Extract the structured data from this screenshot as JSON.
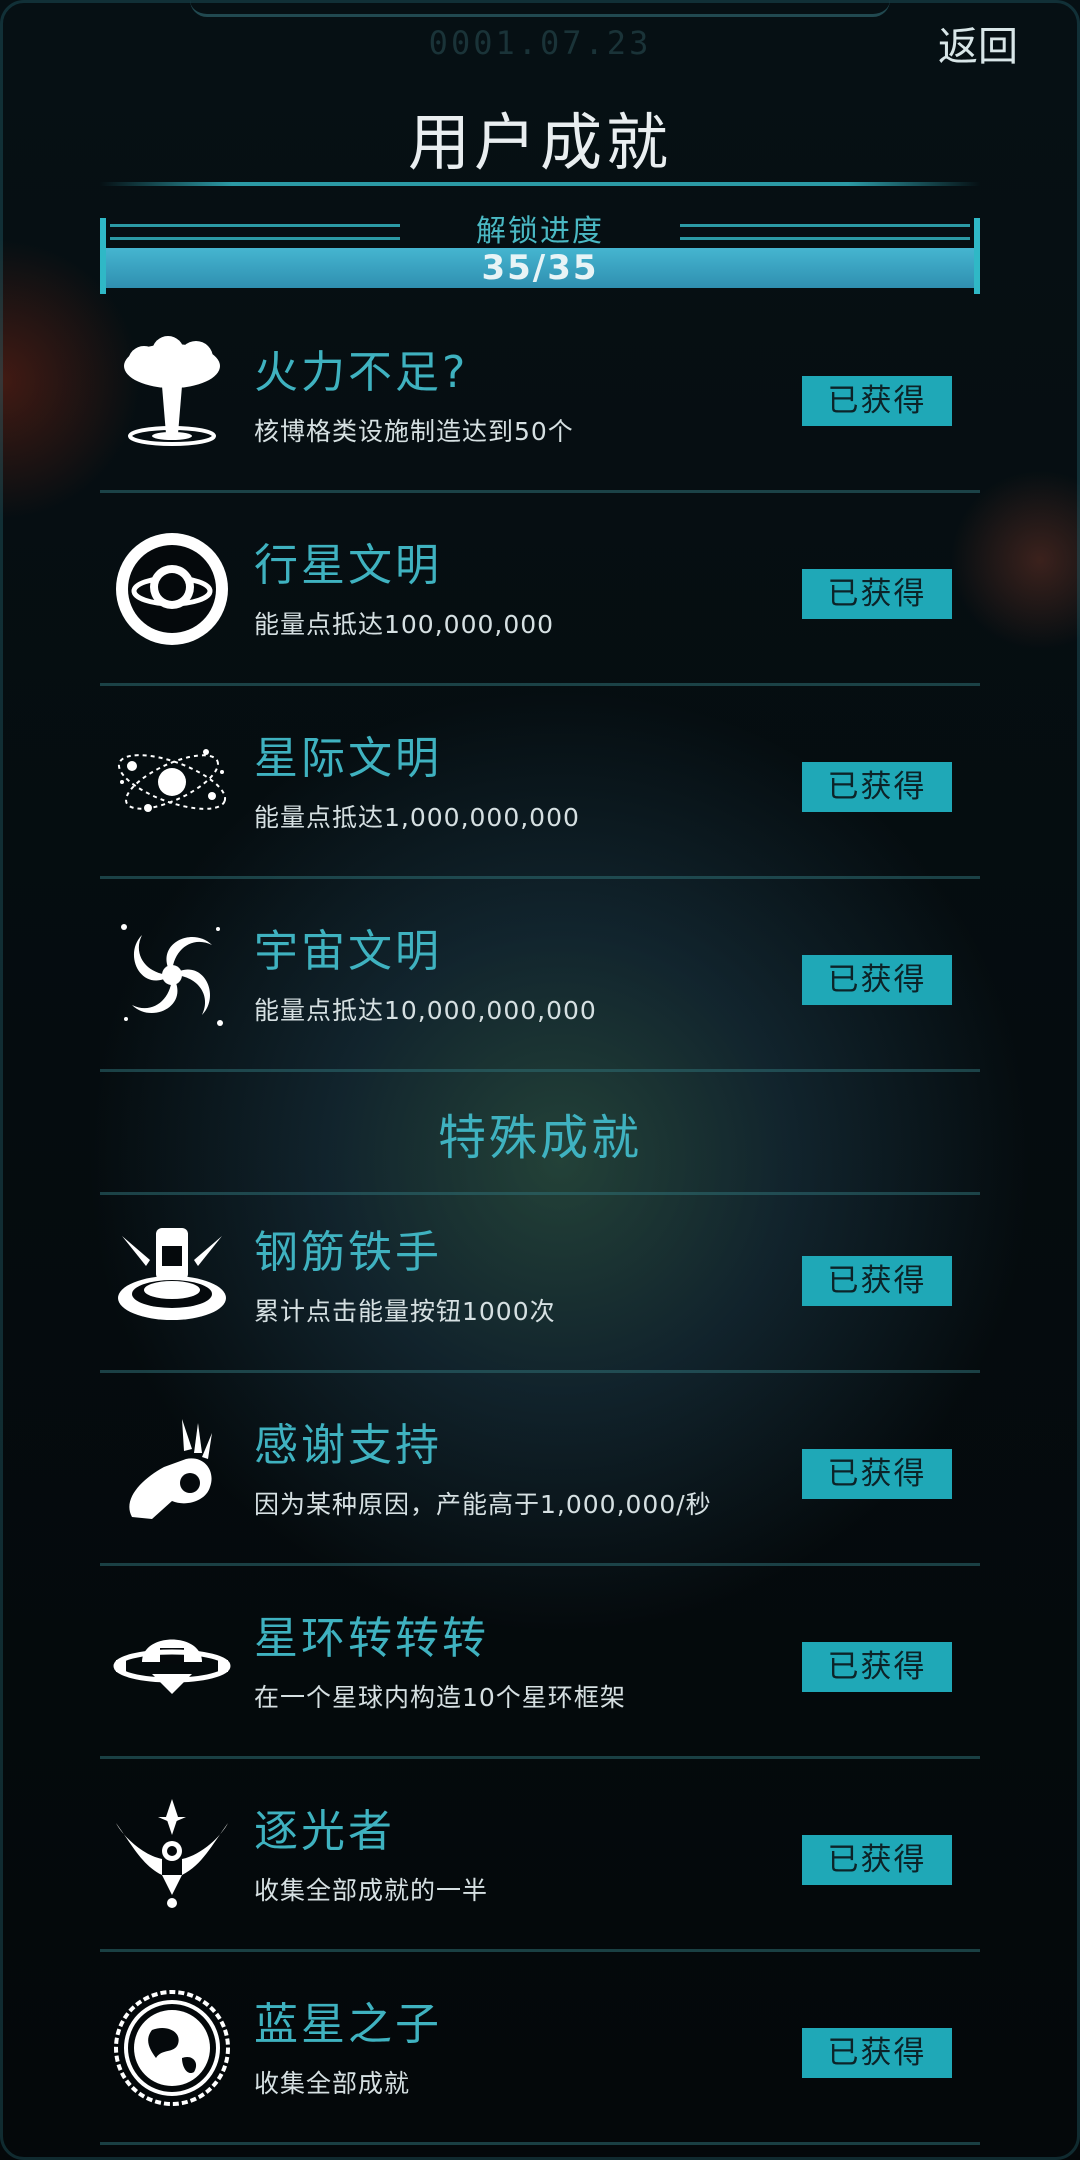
{
  "header": {
    "date": "0001.07.23",
    "back_label": "返回",
    "title": "用户成就"
  },
  "progress": {
    "label": "解锁进度",
    "text": "35/35",
    "unlocked": 35,
    "total": 35,
    "fraction": 1.0
  },
  "achievements": [
    {
      "name": "火力不足?",
      "desc": "核博格类设施制造达到50个",
      "status": "已获得",
      "icon": "mushroom-cloud-icon"
    },
    {
      "name": "行星文明",
      "desc": "能量点抵达100,000,000",
      "status": "已获得",
      "icon": "planet-ring-icon"
    },
    {
      "name": "星际文明",
      "desc": "能量点抵达1,000,000,000",
      "status": "已获得",
      "icon": "star-system-icon"
    },
    {
      "name": "宇宙文明",
      "desc": "能量点抵达10,000,000,000",
      "status": "已获得",
      "icon": "galaxy-spiral-icon"
    }
  ],
  "special": {
    "title": "特殊成就",
    "items": [
      {
        "name": "钢筋铁手",
        "desc": "累计点击能量按钮1000次",
        "status": "已获得",
        "icon": "pressing-button-icon"
      },
      {
        "name": "感谢支持",
        "desc": "因为某种原因，产能高于1,000,000/秒",
        "status": "已获得",
        "icon": "ok-hand-icon"
      },
      {
        "name": "星环转转转",
        "desc": "在一个星球内构造10个星环框架",
        "status": "已获得",
        "icon": "ring-station-icon"
      },
      {
        "name": "逐光者",
        "desc": "收集全部成就的一半",
        "status": "已获得",
        "icon": "winged-emblem-icon"
      },
      {
        "name": "蓝星之子",
        "desc": "收集全部成就",
        "status": "已获得",
        "icon": "earth-seal-icon"
      }
    ]
  },
  "colors": {
    "accent": "#3fb2c0",
    "button": "#1fa8b7",
    "background": "#05090c"
  }
}
